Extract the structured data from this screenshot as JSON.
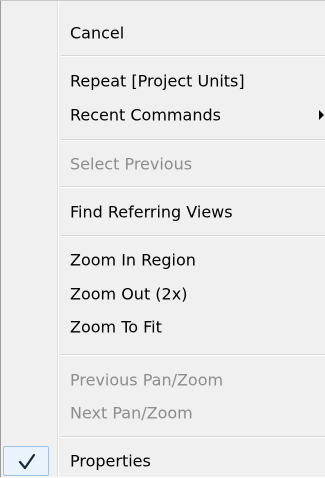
{
  "menu": {
    "items": [
      {
        "label": "Cancel",
        "enabled": true
      },
      {
        "label": "Repeat [Project Units]",
        "enabled": true
      },
      {
        "label": "Recent Commands",
        "enabled": true,
        "submenu": true
      },
      {
        "label": "Select Previous",
        "enabled": false
      },
      {
        "label": "Find Referring Views",
        "enabled": true
      },
      {
        "label": "Zoom In Region",
        "enabled": true
      },
      {
        "label": "Zoom Out (2x)",
        "enabled": true
      },
      {
        "label": "Zoom To Fit",
        "enabled": true
      },
      {
        "label": "Previous Pan/Zoom",
        "enabled": false
      },
      {
        "label": "Next Pan/Zoom",
        "enabled": false
      },
      {
        "label": "Properties",
        "enabled": true,
        "checked": true
      }
    ],
    "icons": {
      "submenu": "chevron-right-icon",
      "check": "check-icon"
    }
  },
  "colors": {
    "background": "#f0f0f0",
    "text": "#000000",
    "disabled_text": "#8d8d8d",
    "check_highlight": "#eaf3fc",
    "check_border": "#9fc4e8"
  }
}
